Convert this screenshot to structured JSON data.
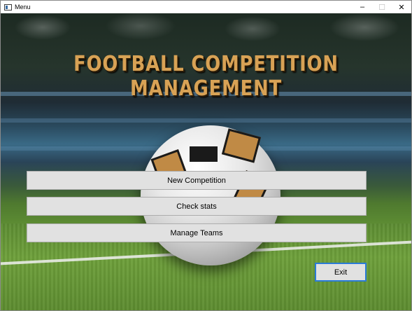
{
  "window": {
    "title": "Menu",
    "controls": {
      "minimize": "–",
      "maximize": "☐",
      "close": "✕"
    }
  },
  "header": {
    "headline": "FOOTBALL COMPETITION MANAGEMENT"
  },
  "menu": {
    "new_competition": "New Competition",
    "check_stats": "Check stats",
    "manage_teams": "Manage Teams",
    "exit": "Exit"
  },
  "icons": {
    "app": "app-window-icon",
    "minimize": "minimize-icon",
    "maximize": "maximize-icon",
    "close": "close-icon"
  },
  "colors": {
    "headline": "#d8a255",
    "button_bg": "#e1e1e1",
    "focus_border": "#2a7bd6"
  }
}
